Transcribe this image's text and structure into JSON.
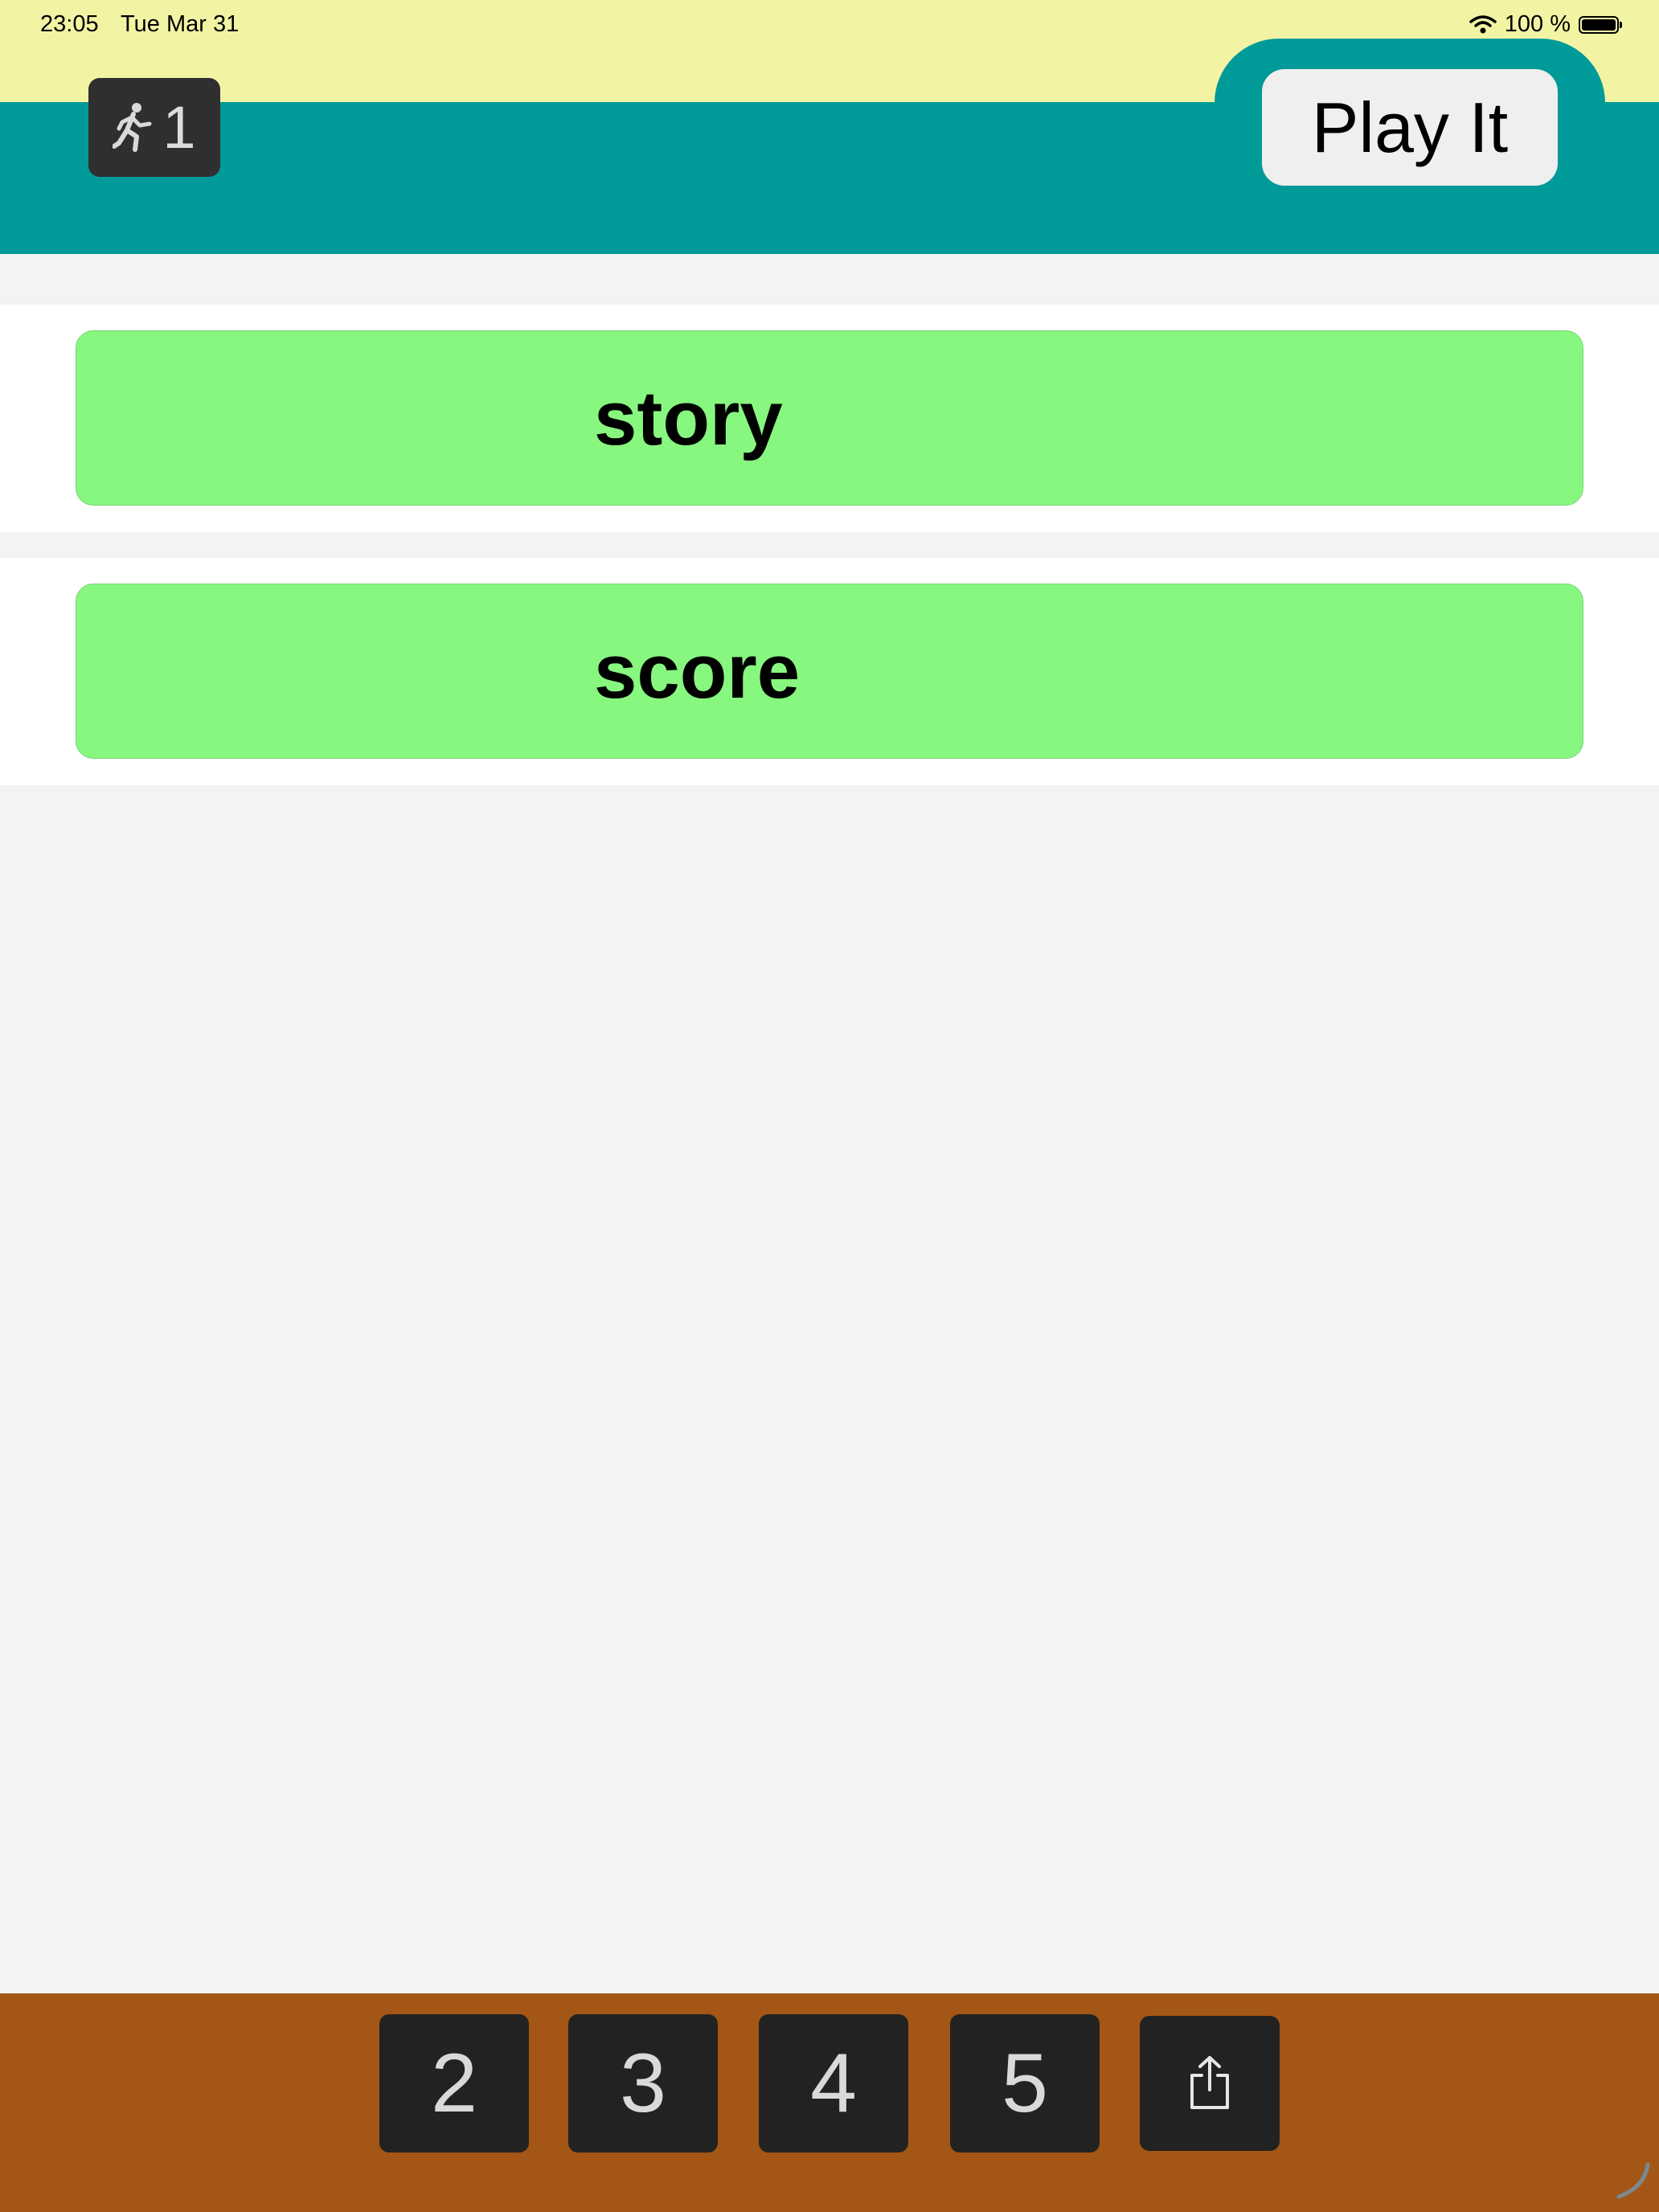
{
  "status_bar": {
    "time": "23:05",
    "date": "Tue Mar 31",
    "battery_text": "100 %",
    "wifi_icon": "wifi-icon",
    "battery_icon": "battery-icon"
  },
  "header": {
    "level_icon": "runner-icon",
    "level_number": "1",
    "play_label": "Play It"
  },
  "words": [
    {
      "text": "story"
    },
    {
      "text": "score"
    }
  ],
  "bottom_bar": {
    "buttons": [
      "2",
      "3",
      "4",
      "5"
    ],
    "share_icon": "share-icon"
  },
  "colors": {
    "status_bg": "#f2f4a4",
    "header_teal": "#009a99",
    "word_card_green": "#87f77f",
    "bottom_bar_brown": "#a35615",
    "dark_button": "#222222"
  }
}
